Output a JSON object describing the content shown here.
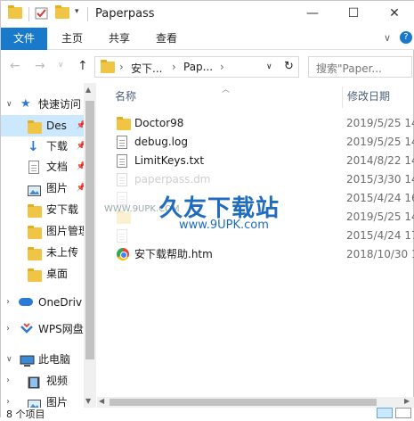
{
  "window": {
    "title": "Paperpass"
  },
  "title_buttons": {
    "minimize": "—",
    "maximize": "☐",
    "close": "✕"
  },
  "ribbon": {
    "tabs": [
      "文件",
      "主页",
      "共享",
      "查看"
    ],
    "expand": "∨",
    "help": "?"
  },
  "address": {
    "segments": [
      "安下...",
      "Pap..."
    ],
    "sep": "›",
    "dropdown": "∨",
    "refresh": "↻"
  },
  "search": {
    "placeholder": "搜索\"Paper..."
  },
  "nav": {
    "items": [
      {
        "label": "快速访问",
        "pinned": false
      },
      {
        "label": "Des",
        "pinned": true
      },
      {
        "label": "下载",
        "pinned": true
      },
      {
        "label": "文档",
        "pinned": true
      },
      {
        "label": "图片",
        "pinned": true
      },
      {
        "label": "安下载",
        "pinned": false
      },
      {
        "label": "图片管理",
        "pinned": false
      },
      {
        "label": "未上传",
        "pinned": false
      },
      {
        "label": "桌面",
        "pinned": false
      },
      {
        "label": "OneDriv",
        "pinned": false
      },
      {
        "label": "WPS网盘",
        "pinned": false
      },
      {
        "label": "此电脑",
        "pinned": false
      },
      {
        "label": "视频",
        "pinned": false
      },
      {
        "label": "图片",
        "pinned": false
      }
    ]
  },
  "columns": {
    "name": "名称",
    "date": "修改日期"
  },
  "files": [
    {
      "name": "Doctor98",
      "date": "2019/5/25 14",
      "type": "folder"
    },
    {
      "name": "debug.log",
      "date": "2019/5/25 14",
      "type": "doc"
    },
    {
      "name": "LimitKeys.txt",
      "date": "2014/8/22 14",
      "type": "doc"
    },
    {
      "name": "paperpass.dm",
      "date": "2015/3/30 14",
      "type": "doc"
    },
    {
      "name": "",
      "date": "2015/4/24 16",
      "type": "doc"
    },
    {
      "name": "",
      "date": "2019/5/25 14",
      "type": "folder"
    },
    {
      "name": "",
      "date": "2015/4/24 17",
      "type": "doc"
    },
    {
      "name": "安下载帮助.htm",
      "date": "2018/10/30 1",
      "type": "htm"
    }
  ],
  "watermark": {
    "logo": "久友下载站",
    "url": "www.9UPK.com",
    "left": "WWW.9UPK.COM"
  },
  "status": {
    "count": "8 个项目"
  }
}
